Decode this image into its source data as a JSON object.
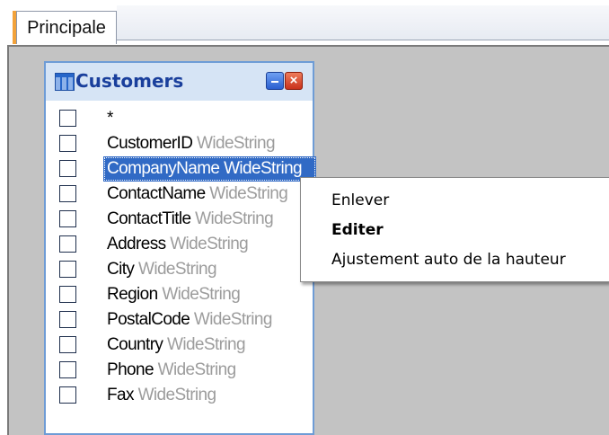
{
  "tabs": [
    {
      "label": "Principale",
      "active": true
    }
  ],
  "table": {
    "title": "Customers",
    "close_glyph": "×",
    "fields": [
      {
        "name": "*",
        "type": ""
      },
      {
        "name": "CustomerID",
        "type": "WideString"
      },
      {
        "name": "CompanyName",
        "type": "WideString",
        "selected": true
      },
      {
        "name": "ContactName",
        "type": "WideString"
      },
      {
        "name": "ContactTitle",
        "type": "WideString"
      },
      {
        "name": "Address",
        "type": "WideString"
      },
      {
        "name": "City",
        "type": "WideString"
      },
      {
        "name": "Region",
        "type": "WideString"
      },
      {
        "name": "PostalCode",
        "type": "WideString"
      },
      {
        "name": "Country",
        "type": "WideString"
      },
      {
        "name": "Phone",
        "type": "WideString"
      },
      {
        "name": "Fax",
        "type": "WideString"
      }
    ]
  },
  "context_menu": {
    "items": [
      {
        "label": "Enlever",
        "bold": false
      },
      {
        "label": "Editer",
        "bold": true
      },
      {
        "label": "Ajustement auto de la hauteur",
        "bold": false
      }
    ]
  },
  "colors": {
    "selection": "#316ac5",
    "workspace": "#c3c3c3",
    "header": "#d6e4f5",
    "title": "#1a3f9c",
    "type_text": "#9c9c9c"
  },
  "icons": {
    "table": "table-grid-icon",
    "minimize": "minimize-icon",
    "close": "close-icon"
  }
}
